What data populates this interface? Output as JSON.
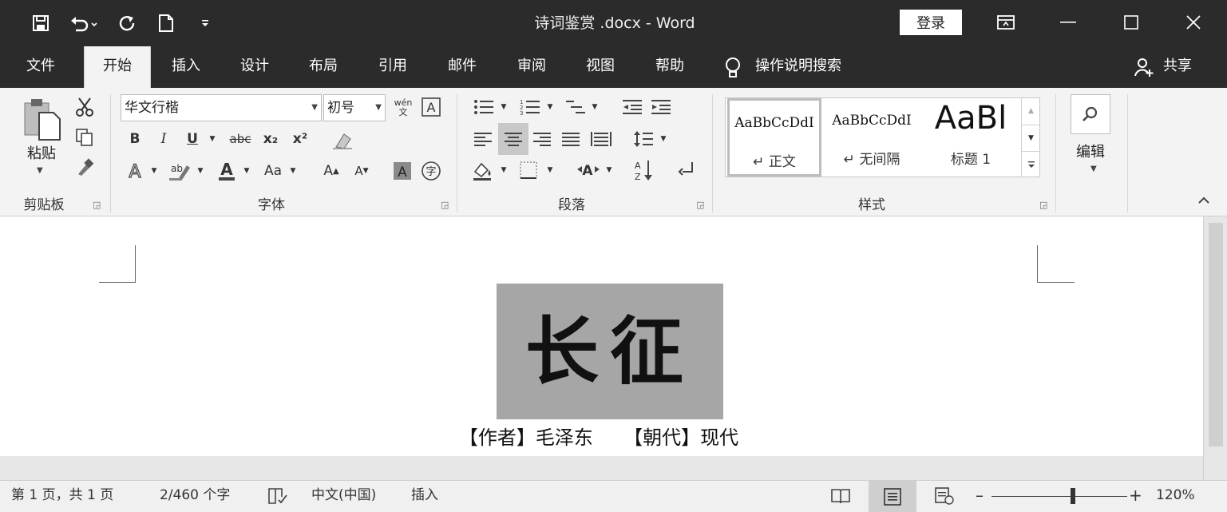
{
  "titlebar": {
    "doc_title": "诗词鉴赏 .docx  -  Word",
    "login_label": "登录"
  },
  "tabs": [
    "文件",
    "开始",
    "插入",
    "设计",
    "布局",
    "引用",
    "邮件",
    "审阅",
    "视图",
    "帮助"
  ],
  "active_tab": "开始",
  "tell_me": "操作说明搜索",
  "share_label": "共享",
  "ribbon": {
    "clipboard": {
      "paste_label": "粘贴",
      "group_label": "剪贴板"
    },
    "font": {
      "font_name": "华文行楷",
      "font_size": "初号",
      "group_label": "字体",
      "bold": "B",
      "italic": "I",
      "underline": "U",
      "strike": "abc",
      "subscript": "x₂",
      "superscript": "x²",
      "grow": "A",
      "shrink": "A",
      "case": "Aa",
      "pinyin": "wén 文"
    },
    "paragraph": {
      "group_label": "段落"
    },
    "styles": {
      "group_label": "样式",
      "items": [
        {
          "preview": "AaBbCcDdI",
          "label": "↵ 正文"
        },
        {
          "preview": "AaBbCcDdI",
          "label": "↵ 无间隔"
        },
        {
          "preview": "AaBl",
          "label": "标题 1"
        }
      ]
    },
    "editing": {
      "label": "编辑"
    }
  },
  "document": {
    "title": "长征",
    "author_line": "【作者】毛泽东     【朝代】现代"
  },
  "statusbar": {
    "page": "第 1 页，共 1 页",
    "words": "2/460 个字",
    "language": "中文(中国)",
    "mode": "插入",
    "zoom": "120%",
    "zoom_level": 0.6
  },
  "colors": {
    "titlebar_bg": "#2b2b2b",
    "ribbon_bg": "#f3f3f3",
    "title_box_bg": "#a6a6a6"
  }
}
